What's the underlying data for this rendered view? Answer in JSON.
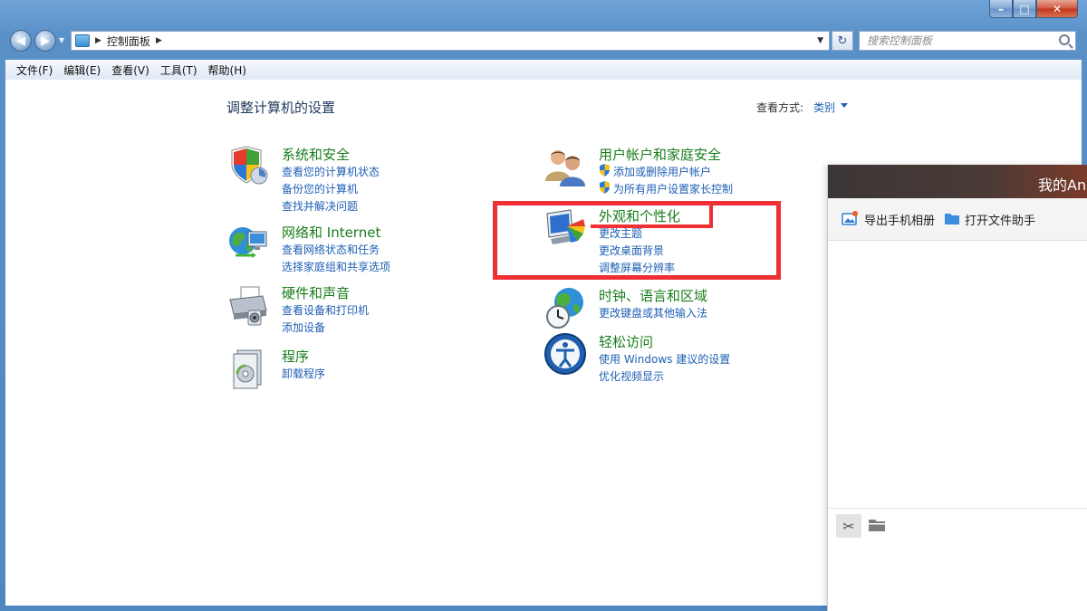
{
  "window": {
    "minimize": "–",
    "maximize": "□",
    "close": "✕"
  },
  "nav": {
    "back_glyph": "◀",
    "forward_glyph": "▶",
    "address": {
      "separator1": "▶",
      "path": "控制面板",
      "separator2": "▶",
      "dropdown_glyph": "▼"
    },
    "refresh_glyph": "↻",
    "search_placeholder": "搜索控制面板"
  },
  "menubar": [
    "文件(F)",
    "编辑(E)",
    "查看(V)",
    "工具(T)",
    "帮助(H)"
  ],
  "content": {
    "title": "调整计算机的设置",
    "view_by_label": "查看方式:",
    "view_by_value": "类别",
    "categories": [
      {
        "title": "系统和安全",
        "links": [
          "查看您的计算机状态",
          "备份您的计算机",
          "查找并解决问题"
        ],
        "icon": "shield-icon"
      },
      {
        "title": "网络和 Internet",
        "links": [
          "查看网络状态和任务",
          "选择家庭组和共享选项"
        ],
        "icon": "network-icon"
      },
      {
        "title": "硬件和声音",
        "links": [
          "查看设备和打印机",
          "添加设备"
        ],
        "icon": "printer-icon"
      },
      {
        "title": "程序",
        "links": [
          "卸载程序"
        ],
        "icon": "programs-icon"
      },
      {
        "title": "用户帐户和家庭安全",
        "links": [
          "添加或删除用户帐户",
          "为所有用户设置家长控制"
        ],
        "icon": "users-icon"
      },
      {
        "title": "外观和个性化",
        "links": [
          "更改主题",
          "更改桌面背景",
          "调整屏幕分辨率"
        ],
        "icon": "personalization-icon"
      },
      {
        "title": "时钟、语言和区域",
        "links": [
          "更改键盘或其他输入法"
        ],
        "icon": "clock-globe-icon"
      },
      {
        "title": "轻松访问",
        "links": [
          "使用 Windows 建议的设置",
          "优化视频显示"
        ],
        "icon": "ease-of-access-icon"
      }
    ]
  },
  "panel": {
    "title": "我的An",
    "export_photos": "导出手机相册",
    "open_file_helper": "打开文件助手",
    "scissor_glyph": "✂"
  },
  "colors": {
    "highlight": "#ee3034",
    "category_title": "#187d1a",
    "link": "#1e5fb4"
  }
}
